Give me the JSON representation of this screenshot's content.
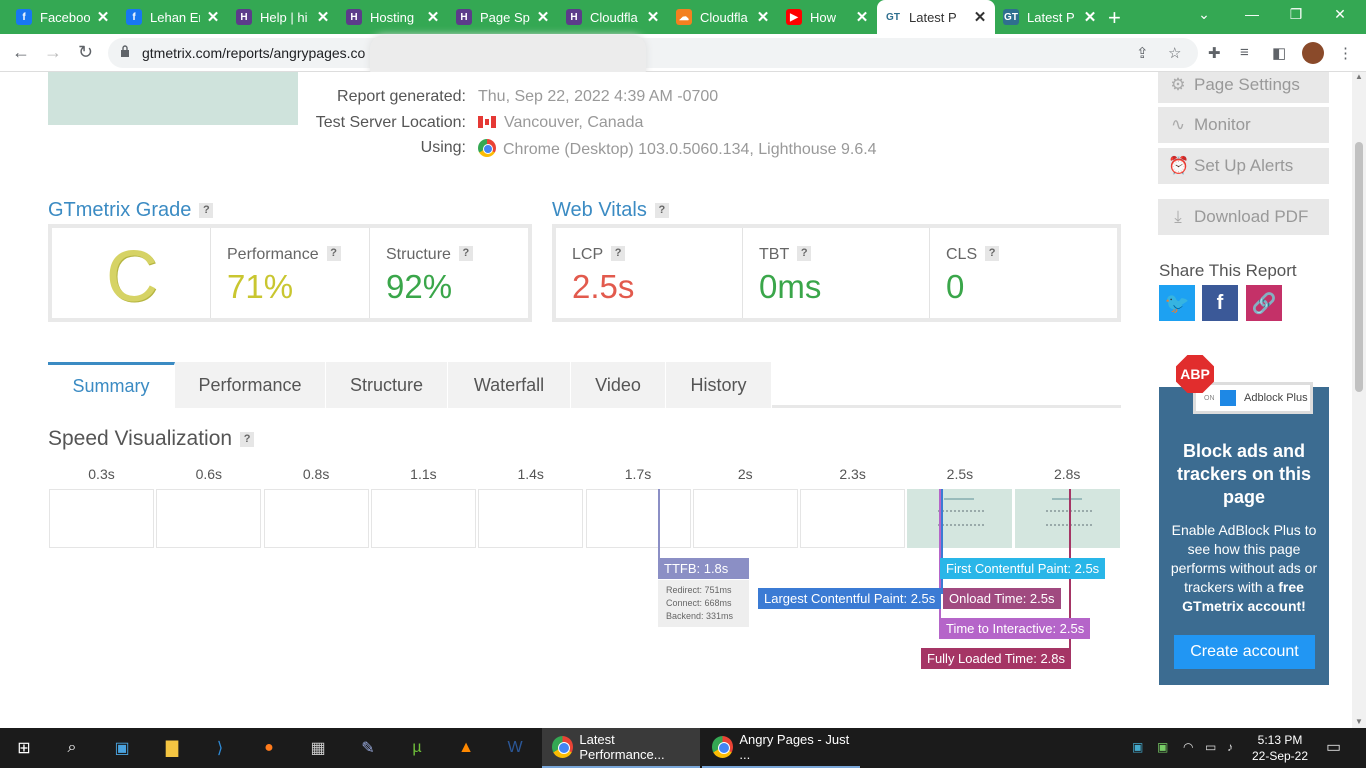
{
  "browser": {
    "tabs": [
      {
        "label": "Faceboo",
        "fav": "f",
        "favbg": "#1877f2"
      },
      {
        "label": "Lehan Er",
        "fav": "f",
        "favbg": "#1877f2"
      },
      {
        "label": "Help | hi",
        "fav": "H",
        "favbg": "#5c3c8a"
      },
      {
        "label": "Hosting",
        "fav": "H",
        "favbg": "#5c3c8a"
      },
      {
        "label": "Page Sp",
        "fav": "H",
        "favbg": "#5c3c8a"
      },
      {
        "label": "Cloudfla",
        "fav": "H",
        "favbg": "#5c3c8a"
      },
      {
        "label": "Cloudfla",
        "fav": "☁",
        "favbg": "#f38020"
      },
      {
        "label": "How",
        "fav": "▶",
        "favbg": "#ff0000"
      },
      {
        "label": "Latest P",
        "fav": "GT",
        "favbg": "#ffffff"
      },
      {
        "label": "Latest P",
        "fav": "GT",
        "favbg": "#2f6f8f"
      }
    ],
    "url": "gtmetrix.com/reports/angrypages.co"
  },
  "report": {
    "generated_label": "Report generated:",
    "generated_value": "Thu, Sep 22, 2022 4:39 AM -0700",
    "location_label": "Test Server Location:",
    "location_value": "Vancouver, Canada",
    "using_label": "Using:",
    "using_value": "Chrome (Desktop) 103.0.5060.134, Lighthouse 9.6.4"
  },
  "grade": {
    "title": "GTmetrix Grade",
    "help": "?",
    "letter": "C",
    "performance_label": "Performance",
    "performance_value": "71%",
    "structure_label": "Structure",
    "structure_value": "92%"
  },
  "vitals": {
    "title": "Web Vitals",
    "help": "?",
    "lcp_label": "LCP",
    "lcp_value": "2.5s",
    "tbt_label": "TBT",
    "tbt_value": "0ms",
    "cls_label": "CLS",
    "cls_value": "0"
  },
  "page_tabs": [
    "Summary",
    "Performance",
    "Structure",
    "Waterfall",
    "Video",
    "History"
  ],
  "speed_viz": {
    "title": "Speed Visualization",
    "help": "?",
    "ticks": [
      "0.3s",
      "0.6s",
      "0.8s",
      "1.1s",
      "1.4s",
      "1.7s",
      "2s",
      "2.3s",
      "2.5s",
      "2.8s"
    ],
    "markers": {
      "ttfb": "TTFB: 1.8s",
      "ttfb_redirect": "Redirect: 751ms",
      "ttfb_connect": "Connect: 668ms",
      "ttfb_backend": "Backend: 331ms",
      "lcp": "Largest Contentful Paint: 2.5s",
      "fcp": "First Contentful Paint: 2.5s",
      "onload": "Onload Time: 2.5s",
      "tti": "Time to Interactive: 2.5s",
      "fully_loaded": "Fully Loaded Time: 2.8s"
    }
  },
  "sidebar": {
    "page_settings": "Page Settings",
    "monitor": "Monitor",
    "alerts": "Set Up Alerts",
    "download_pdf": "Download PDF",
    "share_title": "Share This Report"
  },
  "ad": {
    "badge": "ABP",
    "chip_on": "ON",
    "chip_label": "Adblock Plus",
    "heading": "Block ads and trackers on this page",
    "body": "Enable AdBlock Plus to see how this page performs without ads or trackers with a",
    "body_bold": "free GTmetrix account!",
    "button": "Create account"
  },
  "taskbar": {
    "app1": "Latest Performance...",
    "app2": "Angry Pages - Just ...",
    "time": "5:13 PM",
    "date": "22-Sep-22"
  },
  "colors": {
    "tabstrip": "#34a853",
    "link_blue": "#3b8bc3",
    "grade_c": "#d6d365",
    "perf_yellow": "#c9c630",
    "good_green": "#3aa64a",
    "bad_red": "#e25a4d",
    "ttfb": "#8b8fc5",
    "lcp": "#3b7bd4",
    "fcp": "#29b6e8",
    "onload": "#a04a80",
    "tti": "#b565c9",
    "fully_loaded": "#a53565"
  }
}
